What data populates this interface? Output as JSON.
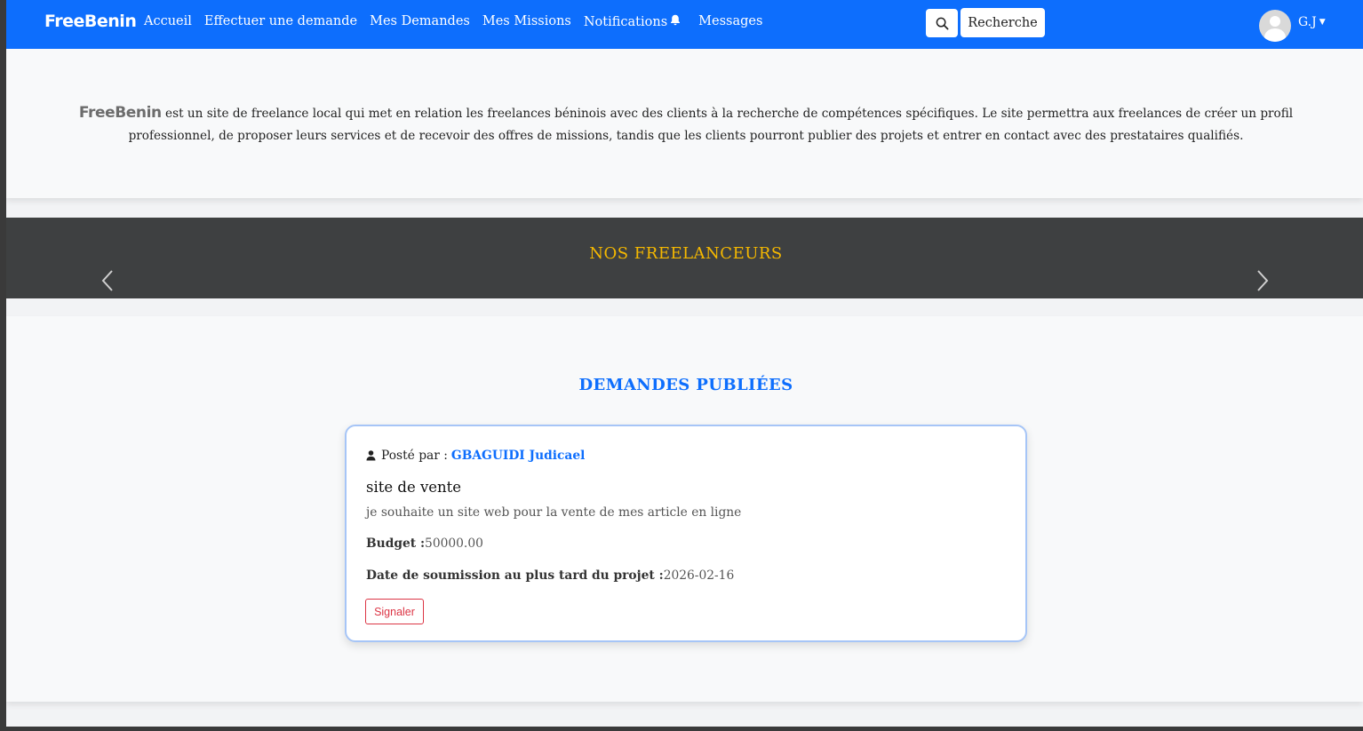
{
  "navbar": {
    "brand": "FreeBenin",
    "links": [
      "Accueil",
      "Effectuer une demande",
      "Mes Demandes",
      "Mes Missions",
      "Notifications",
      "Messages"
    ],
    "search_button_icon": "search-icon",
    "search_label": "Recherche",
    "user_initials": "G.J",
    "accent_color": "#0d6efd"
  },
  "intro": {
    "brand": "FreeBenin",
    "text": " est un site de freelance local qui met en relation les freelances béninois avec des clients à la recherche de compétences spécifiques. Le site permettra aux freelances de créer un profil professionnel, de proposer leurs services et de recevoir des offres de missions, tandis que les clients pourront publier des projets et entrer en contact avec des prestataires qualifiés."
  },
  "freelancers": {
    "title": "NOS FREELANCEURS",
    "title_color": "#f5b800"
  },
  "demandes": {
    "title": "DEMANDES PUBLIÉES",
    "items": [
      {
        "posted_by_label": "Posté par :",
        "author": "GBAGUIDI Judicael",
        "title": "site de vente",
        "description": "je souhaite un site web pour la vente de mes article en ligne",
        "budget_label": "Budget :",
        "budget_value": "50000.00",
        "deadline_label": "Date de soumission au plus tard du projet :",
        "deadline_value": "2026-02-16",
        "report_label": "Signaler"
      }
    ]
  }
}
